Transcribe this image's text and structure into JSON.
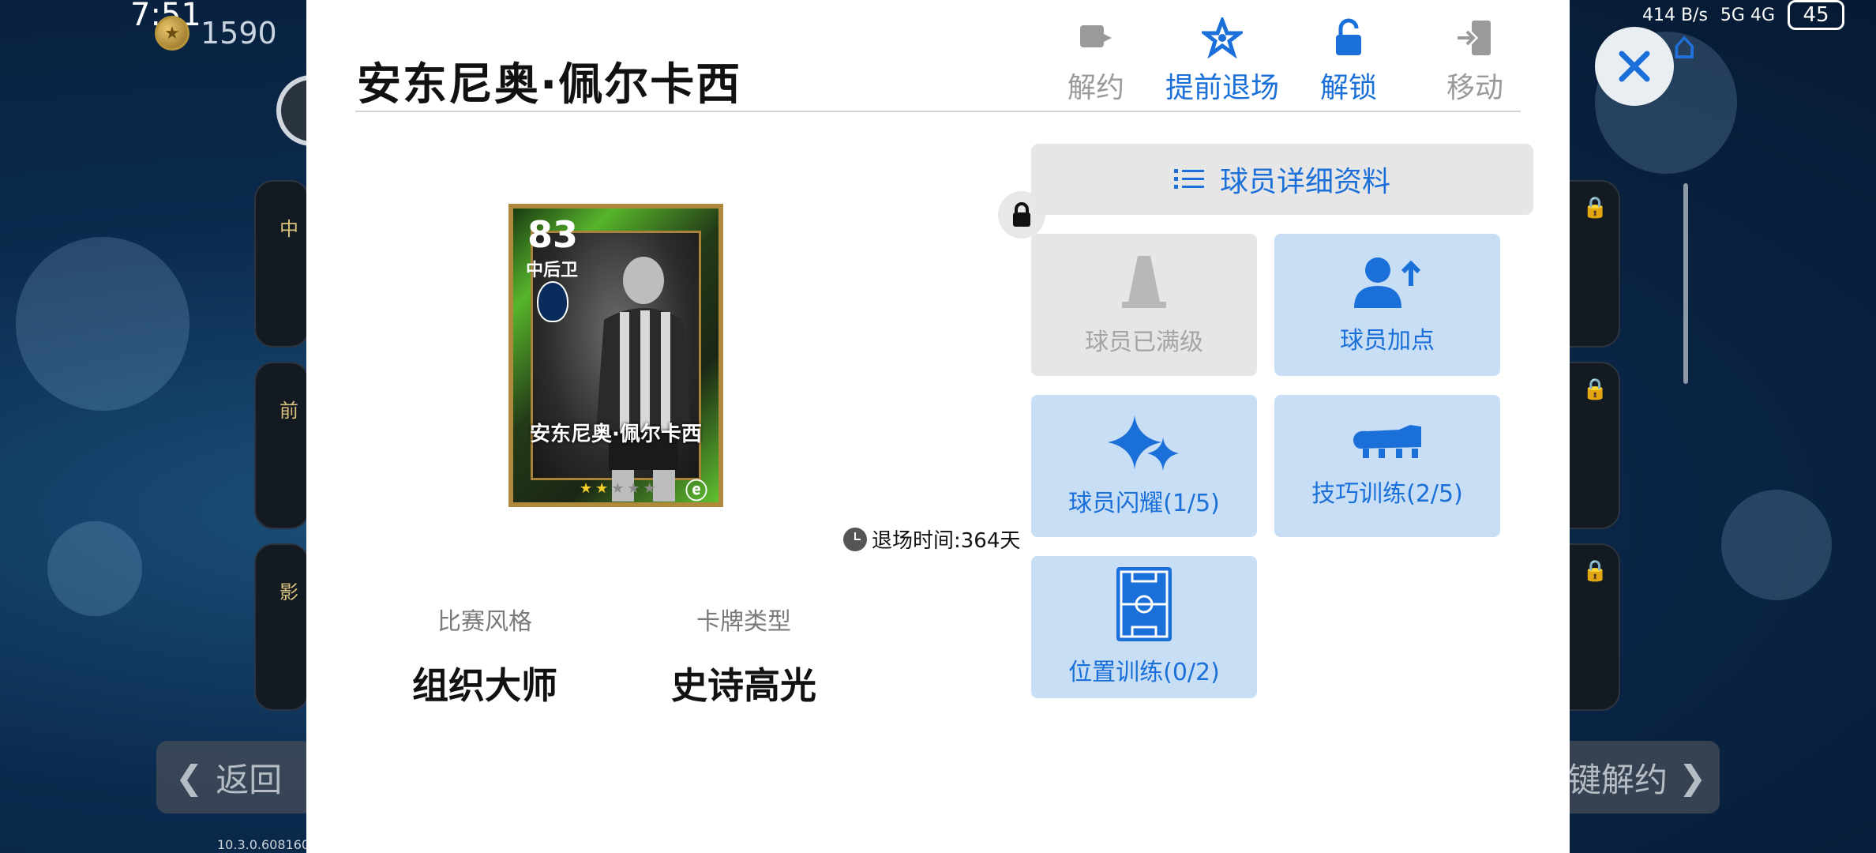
{
  "status_bar": {
    "time": "7:51",
    "net_speed": "414 B/s",
    "network": "5G 4G",
    "battery": "45"
  },
  "background": {
    "coin_value": "1590",
    "back_label": "返回",
    "release_label": "键解约",
    "version": "10.3.0.608160",
    "left_cards": [
      "中",
      "前",
      "影"
    ]
  },
  "modal": {
    "title": "安东尼奥·佩尔卡西",
    "actions": [
      {
        "label": "解约",
        "icon": "release-icon",
        "state": "disabled"
      },
      {
        "label": "提前退场",
        "icon": "star-exit-icon",
        "state": "active"
      },
      {
        "label": "解锁",
        "icon": "unlock-icon",
        "state": "active"
      },
      {
        "label": "移动",
        "icon": "move-icon",
        "state": "disabled"
      }
    ],
    "card": {
      "rating": "83",
      "position": "中后卫",
      "name": "安东尼奥·佩尔卡西",
      "stars_filled": 2,
      "stars_total": 5
    },
    "retire_time": "退场时间:364天",
    "play_style": {
      "label": "比赛风格",
      "value": "组织大师"
    },
    "card_type": {
      "label": "卡牌类型",
      "value": "史诗高光"
    },
    "detail_button": "球员详细资料",
    "tiles": [
      {
        "label": "球员已满级",
        "icon": "training-cone-icon",
        "state": "disabled"
      },
      {
        "label": "球员加点",
        "icon": "user-plus-icon",
        "state": "enabled"
      },
      {
        "label": "球员闪耀(1/5)",
        "icon": "sparkle-icon",
        "state": "enabled"
      },
      {
        "label": "技巧训练(2/5)",
        "icon": "boot-icon",
        "state": "enabled"
      },
      {
        "label": "位置训练(0/2)",
        "icon": "pitch-icon",
        "state": "enabled"
      }
    ]
  },
  "colors": {
    "accent": "#1a6fd9",
    "tile_bg": "#c7def5",
    "disabled_bg": "#e6e6e6"
  }
}
